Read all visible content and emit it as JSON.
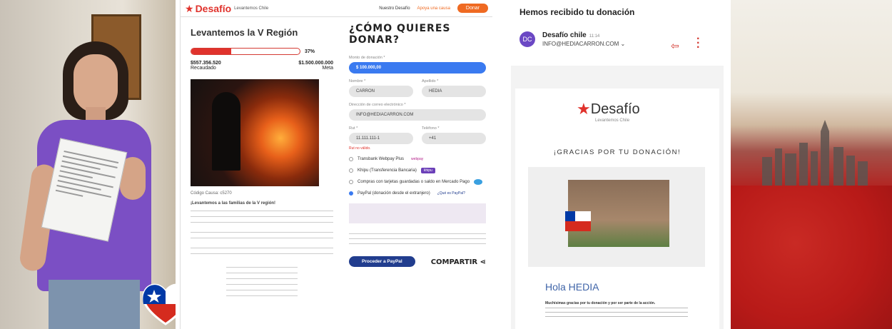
{
  "colors": {
    "brand_red": "#e0322c",
    "orange": "#ef6a22",
    "blue": "#3a7af0",
    "purple": "#6b48c4",
    "paypal_navy": "#213d8e"
  },
  "web": {
    "logo": "Desafío",
    "logo_sub": "Levantemos Chile",
    "nav_item1": "Nuestro Desafío",
    "nav_item2": "Apoya una causa",
    "donar_button": "Donar",
    "page_title": "Levantemos la V Región",
    "progress": {
      "percent_label": "37%",
      "fill_fraction": 0.37
    },
    "raised": {
      "amount": "$557.356.520",
      "label": "Recaudado"
    },
    "goal": {
      "amount": "$1.500.000.000",
      "label": "Meta"
    },
    "cause_code": "Código Causa: c5270",
    "intro_heading": "¡Levantemos a las familias de la V región!",
    "how_heading": "¿CÓMO QUIERES DONAR?",
    "form": {
      "amount_label": "Monto de donación *",
      "amount_value": "$ 100.000,00",
      "name_label": "Nombre *",
      "name_value": "CARRON",
      "lastname_label": "Apellido *",
      "lastname_value": "HEDIA",
      "email_label": "Dirección de correo electrónico *",
      "email_value": "INFO@HEDIACARRON.COM",
      "rut_label": "Rut *",
      "rut_value": "11.111.111-1",
      "phone_label": "Teléfono *",
      "phone_value": "+41",
      "rut_error": "Rut no válido."
    },
    "payment_options": [
      {
        "label": "Transbank Webpay Plus",
        "badge": "webpay"
      },
      {
        "label": "Khipu (Transferencia Bancaria)",
        "badge": "khipu"
      },
      {
        "label": "Compras con tarjetas guardadas o saldo en Mercado Pago",
        "badge": ""
      },
      {
        "label": "PayPal (donación desde el extranjero)",
        "badge": "¿Qué es PayPal?"
      }
    ],
    "proceed_button": "Proceder a PayPal",
    "share_label": "COMPARTIR"
  },
  "email": {
    "subject": "Hemos recibido tu donación",
    "avatar_initials": "DC",
    "sender_name": "Desafío chile",
    "time": "11:14",
    "to_address": "INFO@HEDIACARRON.COM",
    "logo": "Desafío",
    "logo_sub": "Levantemos Chile",
    "thanks": "¡GRACIAS POR TU DONACIÓN!",
    "greeting": "Hola HEDIA",
    "body_bold": "Muchísimas gracias por tu donación y por ser parte de la acción."
  },
  "icons": [
    "star-logo-icon",
    "chevron-down-icon",
    "reply-icon",
    "more-vertical-icon",
    "share-icon",
    "chile-heart-icon"
  ]
}
